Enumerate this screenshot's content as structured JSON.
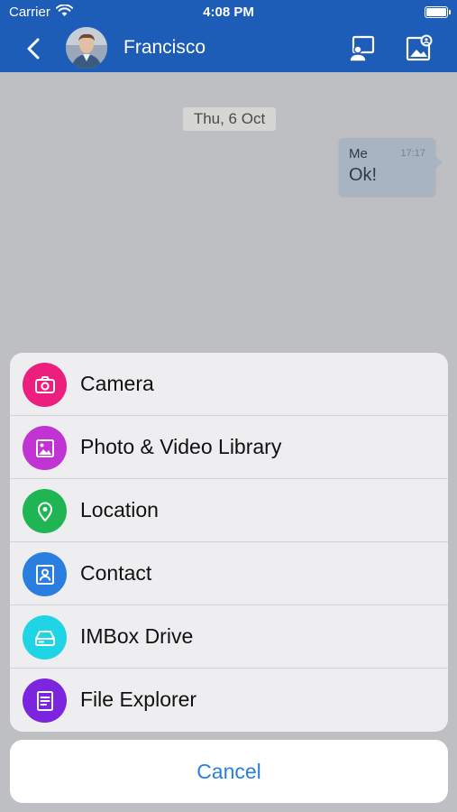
{
  "status": {
    "carrier": "Carrier",
    "time": "4:08 PM"
  },
  "nav": {
    "contact_name": "Francisco"
  },
  "chat": {
    "date": "Thu, 6 Oct",
    "message": {
      "sender": "Me",
      "time": "17:17",
      "text": "Ok!"
    }
  },
  "sheet": {
    "items": [
      {
        "label": "Camera",
        "color": "#ec1f7e",
        "icon": "camera-icon"
      },
      {
        "label": "Photo & Video Library",
        "color": "#c233d4",
        "icon": "image-icon"
      },
      {
        "label": "Location",
        "color": "#1fb552",
        "icon": "location-pin-icon"
      },
      {
        "label": "Contact",
        "color": "#2a7ee0",
        "icon": "contact-card-icon"
      },
      {
        "label": "IMBox Drive",
        "color": "#1fd4e4",
        "icon": "drive-icon"
      },
      {
        "label": "File Explorer",
        "color": "#7b25de",
        "icon": "document-icon"
      }
    ],
    "cancel_label": "Cancel"
  },
  "colors": {
    "nav": "#1d5cb7",
    "accent": "#2a7ee0"
  }
}
